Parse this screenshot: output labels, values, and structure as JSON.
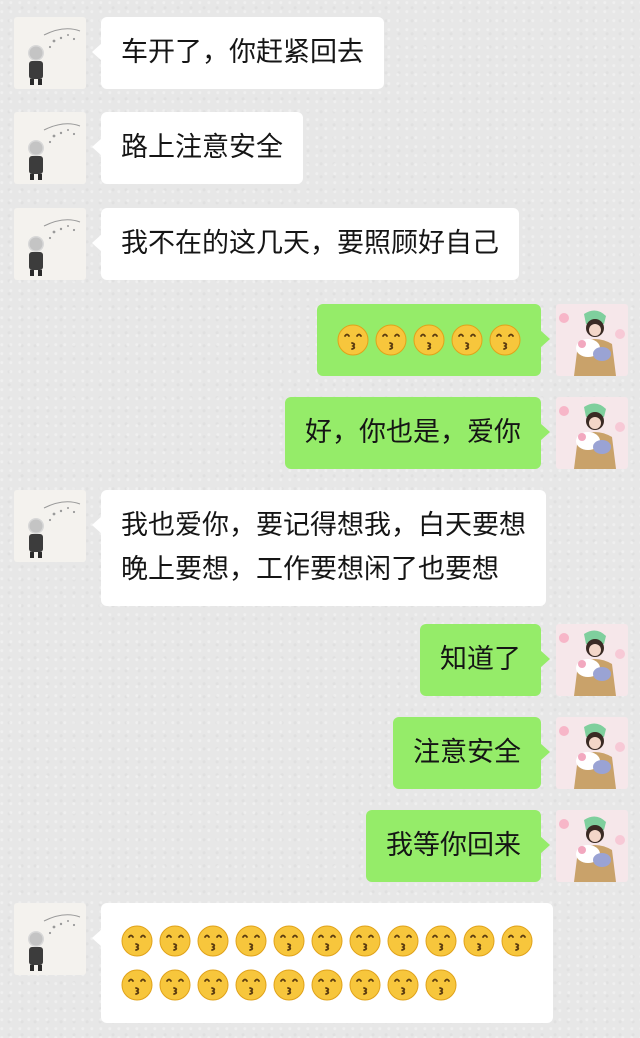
{
  "messages": [
    {
      "side": "in",
      "text": "车开了，你赶紧回去"
    },
    {
      "side": "in",
      "text": "路上注意安全"
    },
    {
      "side": "in",
      "text": "我不在的这几天，要照顾好自己"
    },
    {
      "side": "out",
      "emoji": "kissing-face",
      "emoji_count": 5
    },
    {
      "side": "out",
      "text": "好，你也是，爱你"
    },
    {
      "side": "in",
      "lines": [
        "我也爱你，要记得想我，白天要想",
        "晚上要想，工作要想闲了也要想"
      ]
    },
    {
      "side": "out",
      "text": "知道了"
    },
    {
      "side": "out",
      "text": "注意安全"
    },
    {
      "side": "out",
      "text": "我等你回来"
    },
    {
      "side": "in",
      "emoji": "kissing-face",
      "emoji_rows": [
        11,
        9
      ]
    }
  ],
  "avatars": {
    "contact": "contact-avatar",
    "self": "self-avatar"
  },
  "colors": {
    "background": "#e7e7e7",
    "incoming_bubble": "#ffffff",
    "outgoing_bubble": "#95ec69",
    "emoji_face": "#f7c63c"
  }
}
